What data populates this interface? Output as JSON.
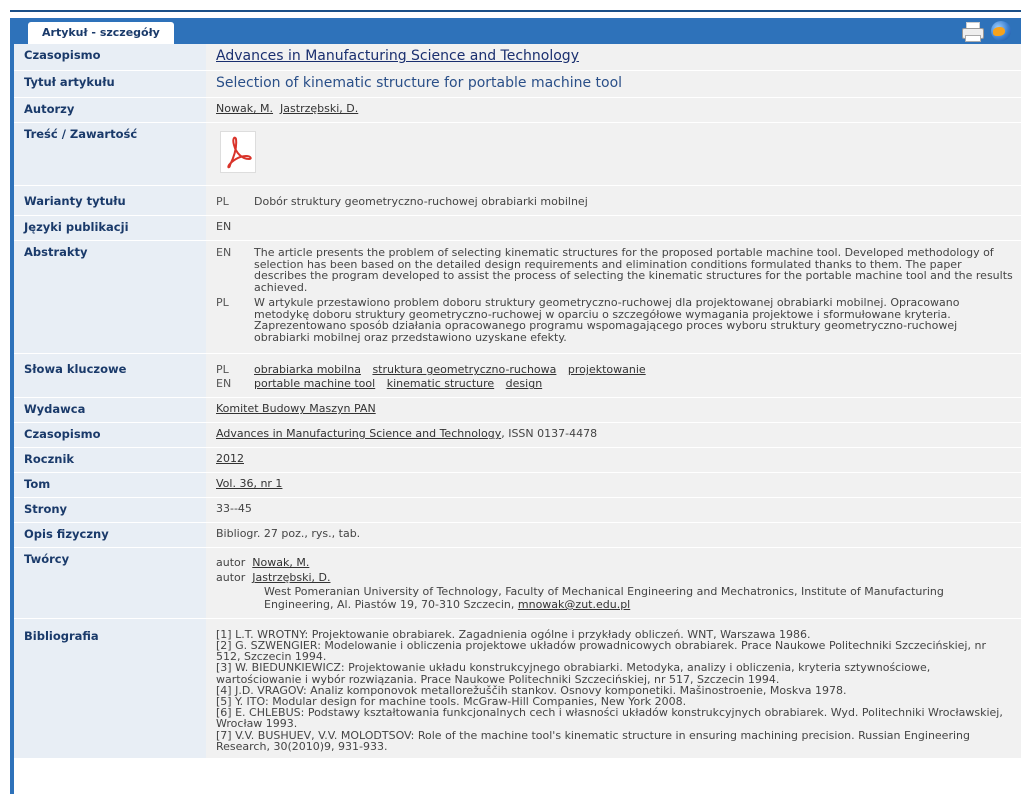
{
  "tab": {
    "label": "Artykuł - szczegóły"
  },
  "rows": {
    "journal": {
      "label": "Czasopismo",
      "value": "Advances in Manufacturing Science and Technology"
    },
    "title": {
      "label": "Tytuł artykułu",
      "value": "Selection of kinematic structure for portable machine tool"
    },
    "authors": {
      "label": "Autorzy",
      "items": [
        "Nowak, M.",
        "Jastrzębski, D."
      ]
    },
    "content": {
      "label": "Treść / Zawartość",
      "icon": "pdf-icon"
    },
    "title_variants": {
      "label": "Warianty tytułu",
      "lang": "PL",
      "value": "Dobór struktury geometryczno-ruchowej obrabiarki mobilnej"
    },
    "languages": {
      "label": "Języki publikacji",
      "value": "EN"
    },
    "abstracts": {
      "label": "Abstrakty",
      "items": [
        {
          "lang": "EN",
          "text": "The article presents the problem of selecting kinematic structures for the proposed portable machine tool. Developed methodology of selection has been based on the detailed design requirements and elimination conditions formulated thanks to them. The paper describes the program developed to assist the process of selecting the kinematic structures for the portable machine tool and the results achieved."
        },
        {
          "lang": "PL",
          "text": "W artykule przestawiono problem doboru struktury geometryczno-ruchowej dla projektowanej obrabiarki mobilnej. Opracowano metodykę doboru struktury geometryczno-ruchowej w oparciu o szczegółowe wymagania projektowe i sformułowane kryteria. Zaprezentowano sposób działania opracowanego programu wspomagającego proces wyboru struktury geometryczno-ruchowej obrabiarki mobilnej oraz przedstawiono uzyskane efekty."
        }
      ]
    },
    "keywords": {
      "label": "Słowa kluczowe",
      "items": [
        {
          "lang": "PL",
          "words": [
            "obrabiarka mobilna",
            "struktura geometryczno-ruchowa",
            "projektowanie"
          ]
        },
        {
          "lang": "EN",
          "words": [
            "portable machine tool",
            "kinematic structure",
            "design"
          ]
        }
      ]
    },
    "publisher": {
      "label": "Wydawca",
      "value": "Komitet Budowy Maszyn PAN"
    },
    "journal2": {
      "label": "Czasopismo",
      "value": "Advances in Manufacturing Science and Technology",
      "issn": ", ISSN 0137-4478"
    },
    "year": {
      "label": "Rocznik",
      "value": "2012"
    },
    "volume": {
      "label": "Tom",
      "value": "Vol. 36, nr 1"
    },
    "pages": {
      "label": "Strony",
      "value": "33--45"
    },
    "physical": {
      "label": "Opis fizyczny",
      "value": "Bibliogr. 27 poz., rys., tab."
    },
    "creators": {
      "label": "Twórcy",
      "role": "autor",
      "items": [
        "Nowak, M.",
        "Jastrzębski, D."
      ],
      "affiliation": "West Pomeranian University of Technology, Faculty of Mechanical Engineering and Mechatronics, Institute of Manufacturing Engineering, Al. Piastów 19, 70-310 Szczecin, ",
      "email": "mnowak@zut.edu.pl"
    },
    "bibliography": {
      "label": "Bibliografia",
      "items": [
        "[1] L.T. WROTNY: Projektowanie obrabiarek. Zagadnienia ogólne i przykłady obliczeń. WNT, Warszawa 1986.",
        "[2] G. SZWENGIER: Modelowanie i obliczenia projektowe układów prowadnicowych obrabiarek. Prace Naukowe Politechniki Szczecińskiej, nr 512, Szczecin 1994.",
        "[3] W. BIEDUNKIEWICZ: Projektowanie układu konstrukcyjnego obrabiarki. Metodyka, analizy i obliczenia, kryteria sztywnościowe, wartościowanie i wybór rozwiązania. Prace Naukowe Politechniki Szczecińskiej, nr 517, Szczecin 1994.",
        "[4] J.D. VRAGOV: Analiz komponovok metallorežuščih stankov. Osnovy komponetiki. Mašinostroenie, Moskva 1978.",
        "[5] Y. ITO: Modular design for machine tools. McGraw-Hill Companies, New York 2008.",
        "[6] E. CHLEBUS: Podstawy kształtowania funkcjonalnych cech i własności układów konstrukcyjnych obrabiarek. Wyd. Politechniki Wrocławskiej, Wrocław 1993.",
        "[7] V.V. BUSHUEV, V.V. MOLODTSOV: Role of the machine tool's kinematic structure in ensuring machining precision. Russian Engineering Research, 30(2010)9, 931-933."
      ]
    }
  },
  "colors": {
    "accent": "#2e72ba",
    "label_bg": "#e8eef5",
    "value_bg": "#f1f1f1",
    "label_text": "#1a3a6a"
  },
  "toolbar": {
    "icons": [
      "print-icon",
      "globe-icon"
    ]
  }
}
